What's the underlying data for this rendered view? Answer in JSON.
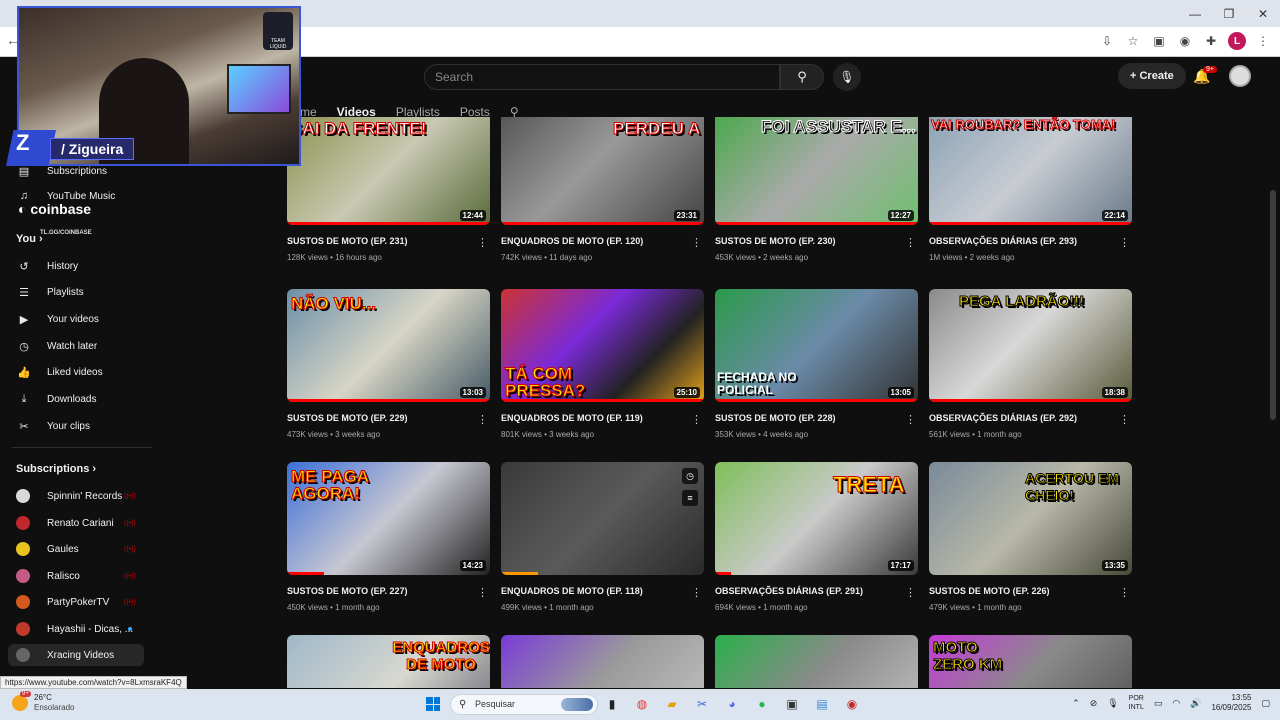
{
  "window": {
    "min": "—",
    "max": "❐",
    "close": "✕"
  },
  "overlay": {
    "streamer_name": "/ Zigueira",
    "team_name": "TEAM LIQUID",
    "sponsor": "coinbase",
    "sponsor_url": "TL.GG/COINBASE"
  },
  "topbar": {
    "search_placeholder": "Search",
    "create_label": "Create",
    "notif_count": "9+"
  },
  "channel_tabs": [
    "me",
    "Videos",
    "Playlists",
    "Posts"
  ],
  "sidebar": {
    "top_items": [
      {
        "label": "Subscriptions",
        "icon": "subscriptions-icon"
      },
      {
        "label": "YouTube Music",
        "icon": "music-icon"
      }
    ],
    "you_label": "You",
    "you_items": [
      {
        "label": "History",
        "icon": "history-icon"
      },
      {
        "label": "Playlists",
        "icon": "playlists-icon"
      },
      {
        "label": "Your videos",
        "icon": "your-videos-icon"
      },
      {
        "label": "Watch later",
        "icon": "clock-icon"
      },
      {
        "label": "Liked videos",
        "icon": "thumb-up-icon"
      },
      {
        "label": "Downloads",
        "icon": "download-icon"
      },
      {
        "label": "Your clips",
        "icon": "scissors-icon"
      }
    ],
    "subs_label": "Subscriptions",
    "subscriptions": [
      {
        "label": "Spinnin' Records",
        "color": "#d9d9d9",
        "live": true
      },
      {
        "label": "Renato Cariani",
        "color": "#c0282d",
        "live": true
      },
      {
        "label": "Gaules",
        "color": "#e8c21d",
        "live": true
      },
      {
        "label": "Ralisco",
        "color": "#c45a86",
        "live": true
      },
      {
        "label": "PartyPokerTV",
        "color": "#d35a1c",
        "live": true
      },
      {
        "label": "Hayashii - Dicas, ...",
        "color": "#c0392b",
        "dot": true
      },
      {
        "label": "Xracing Videos",
        "color": "#666666"
      }
    ]
  },
  "videos": [
    {
      "title": "SUSTOS DE MOTO (EP. 231)",
      "meta": "128K views • 16 hours ago",
      "duration": "12:44",
      "thumb_text": "SAI DA FRENTE!"
    },
    {
      "title": "ENQUADROS DE MOTO (EP. 120)",
      "meta": "742K views • 11 days ago",
      "duration": "23:31",
      "thumb_text": "PERDEU A MOTO!"
    },
    {
      "title": "SUSTOS DE MOTO (EP. 230)",
      "meta": "453K views • 2 weeks ago",
      "duration": "12:27",
      "thumb_text": "FOI ASSUSTAR E..."
    },
    {
      "title": "OBSERVAÇÕES DIÁRIAS (EP. 293)",
      "meta": "1M views • 2 weeks ago",
      "duration": "22:14",
      "thumb_text": "VAI ROUBAR? ENTÃO TOMA!"
    },
    {
      "title": "SUSTOS DE MOTO (EP. 229)",
      "meta": "473K views • 3 weeks ago",
      "duration": "13:03",
      "thumb_text": "NÃO VIU..."
    },
    {
      "title": "ENQUADROS DE MOTO (EP. 119)",
      "meta": "801K views • 3 weeks ago",
      "duration": "25:10",
      "thumb_text": "TÁ COM PRESSA?"
    },
    {
      "title": "SUSTOS DE MOTO (EP. 228)",
      "meta": "353K views • 4 weeks ago",
      "duration": "13:05",
      "thumb_text": "FECHADA NO POLICIAL"
    },
    {
      "title": "OBSERVAÇÕES DIÁRIAS (EP. 292)",
      "meta": "561K views • 1 month ago",
      "duration": "18:38",
      "thumb_text": "PEGA LADRÃO!!!"
    },
    {
      "title": "SUSTOS DE MOTO (EP. 227)",
      "meta": "450K views • 1 month ago",
      "duration": "14:23",
      "thumb_text": "ME PAGA AGORA!"
    },
    {
      "title": "ENQUADROS DE MOTO (EP. 118)",
      "meta": "499K views • 1 month ago",
      "duration": "",
      "thumb_text": ""
    },
    {
      "title": "OBSERVAÇÕES DIÁRIAS (EP. 291)",
      "meta": "694K views • 1 month ago",
      "duration": "17:17",
      "thumb_text": "TRETA"
    },
    {
      "title": "SUSTOS DE MOTO (EP. 226)",
      "meta": "479K views • 1 month ago",
      "duration": "13:35",
      "thumb_text": "ACERTOU EM CHEIO!"
    },
    {
      "title": "",
      "meta": "",
      "duration": "",
      "thumb_text": "ENQUADROS DE MOTO"
    },
    {
      "title": "",
      "meta": "",
      "duration": "",
      "thumb_text": ""
    },
    {
      "title": "",
      "meta": "",
      "duration": "",
      "thumb_text": ""
    },
    {
      "title": "",
      "meta": "",
      "duration": "",
      "thumb_text": "MOTO ZERO KM"
    }
  ],
  "status_url": "https://www.youtube.com/watch?v=8LxmsraKF4Q",
  "taskbar": {
    "weather_temp": "26°C",
    "weather_desc": "Ensolarado",
    "weather_badge": "9+",
    "search_label": "Pesquisar",
    "lang_1": "POR",
    "lang_2": "INTL",
    "time": "13:55",
    "date": "16/09/2025"
  }
}
